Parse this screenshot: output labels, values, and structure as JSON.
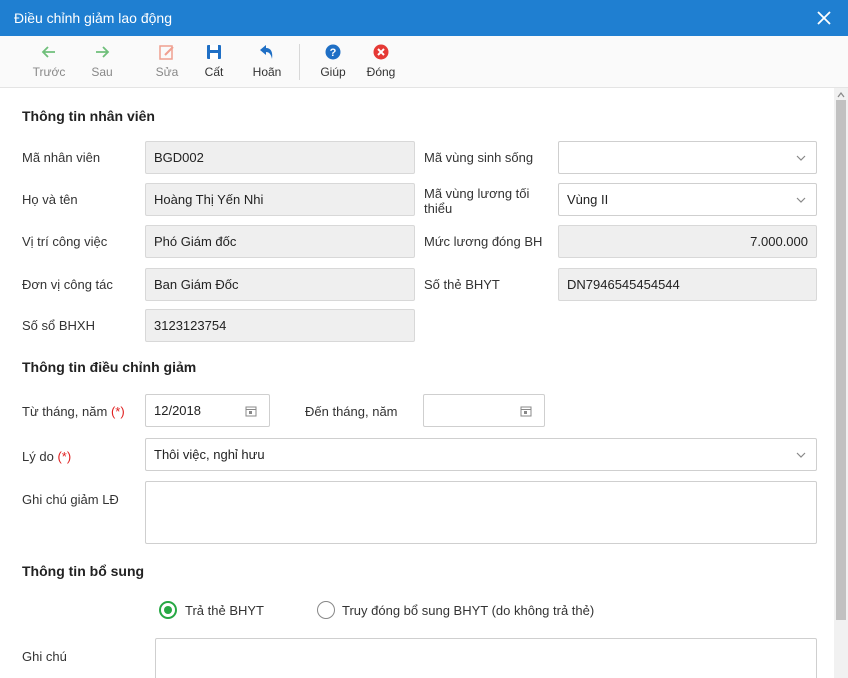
{
  "window": {
    "title": "Điều chỉnh giảm lao động"
  },
  "toolbar": {
    "prev": "Trước",
    "next": "Sau",
    "edit": "Sửa",
    "save": "Cất",
    "undo": "Hoãn",
    "help": "Giúp",
    "close": "Đóng"
  },
  "colors": {
    "accent": "#1f7fd1",
    "help": "#1f6fc5",
    "close": "#e53935",
    "radio": "#27a844"
  },
  "employee": {
    "section_title": "Thông tin nhân viên",
    "code_label": "Mã nhân viên",
    "code": "BGD002",
    "name_label": "Họ và tên",
    "name": "Hoàng Thị Yến Nhi",
    "position_label": "Vị trí công việc",
    "position": "Phó Giám đốc",
    "unit_label": "Đơn vị công tác",
    "unit": "Ban Giám Đốc",
    "bhxh_label": "Số sổ BHXH",
    "bhxh": "3123123754",
    "region_label": "Mã vùng sinh sống",
    "region": "",
    "min_wage_region_label_1": "Mã vùng lương tối",
    "min_wage_region_label_2": "thiểu",
    "min_wage_region": "Vùng II",
    "salary_label": "Mức lương đóng BH",
    "salary": "7.000.000",
    "bhyt_label": "Số thẻ BHYT",
    "bhyt": "DN7946545454544"
  },
  "adjustment": {
    "section_title": "Thông tin điều chỉnh giảm",
    "from_label": "Từ tháng, năm",
    "from": "12/2018",
    "to_label": "Đến tháng, năm",
    "to": "",
    "reason_label": "Lý do",
    "reason": "Thôi việc, nghỉ hưu",
    "note_label": "Ghi chú giảm LĐ",
    "note": "",
    "required_mark": "(*)"
  },
  "extra": {
    "section_title": "Thông tin bổ sung",
    "option_return": "Trả thẻ BHYT",
    "option_pay": "Truy đóng bổ sung BHYT (do không trả thẻ)",
    "note_label": "Ghi chú",
    "note": ""
  }
}
